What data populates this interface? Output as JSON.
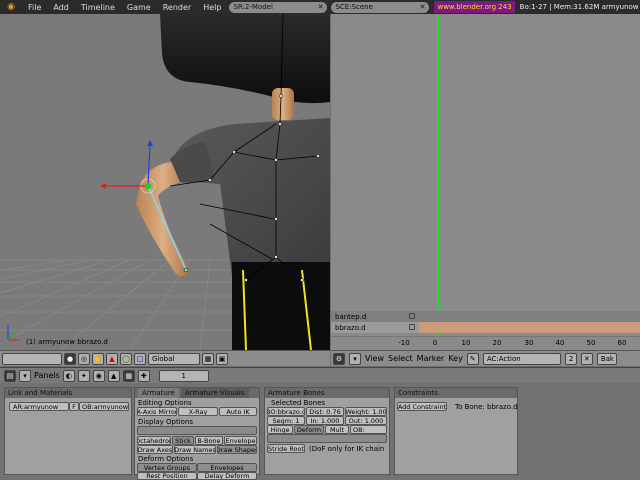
{
  "topbar": {
    "menus": [
      "File",
      "Add",
      "Timeline",
      "Game",
      "Render",
      "Help"
    ],
    "screen": "SR:2-Model",
    "scene": "SCE:Scene",
    "url": "www.blender.org 243",
    "stats": "Bo:1-27 | Mem:31.62M armyunow"
  },
  "viewport": {
    "label": "(1) armyunow bbrazo.d"
  },
  "action": {
    "channels": [
      {
        "name": "bantep.d"
      },
      {
        "name": "bbrazo.d"
      }
    ],
    "ticks": [
      "-10",
      "0",
      "10",
      "20",
      "30",
      "40",
      "50",
      "60"
    ],
    "menus": [
      "View",
      "Select",
      "Marker",
      "Key"
    ],
    "action_name": "AC:Action",
    "users": "2",
    "bake": "Bak"
  },
  "hdr3d": {
    "orientation": "Global"
  },
  "buttons_header": {
    "panels_label": "Panels",
    "frame": "1"
  },
  "panels": {
    "link": {
      "title": "Link and Materials",
      "armature": "AR:armyunow",
      "f": "F",
      "object": "OB:armyunow"
    },
    "armature": {
      "tab1": "Armature",
      "tab2": "Armature Visuals",
      "editing": "Editing Options",
      "xaxis": "X-Axis Mirror",
      "xray": "X-Ray",
      "autoik": "Auto IK",
      "display": "Display Options",
      "octahedron": "Octahedron",
      "stick": "Stick",
      "bbone": "B-Bone",
      "envelope": "Envelope",
      "drawaxes": "Draw Axes",
      "drawnames": "Draw Names",
      "drawshapes": "Draw Shapes",
      "deform": "Deform Options",
      "vgroups": "Vertex Groups",
      "envelopes": "Envelopes",
      "restpos": "Rest Position",
      "delaydeform": "Delay Deform"
    },
    "bones": {
      "title": "Armature Bones",
      "selected": "Selected Bones",
      "bone": "BO:bbrazo.d",
      "dist": "Dist: 0.76",
      "weight": "Weight: 1.00",
      "segm": "Segm: 1",
      "in": "In: 1.000",
      "out": "Out: 1.000",
      "hinge": "Hinge",
      "deform": "Deform",
      "mult": "Mult",
      "ob": "OB:",
      "strideroot": "Stride Root",
      "dof": "(DoF only for IK chain"
    },
    "constraints": {
      "title": "Constraints",
      "add": "Add Constraint",
      "tobone": "To Bone: bbrazo.d"
    }
  }
}
